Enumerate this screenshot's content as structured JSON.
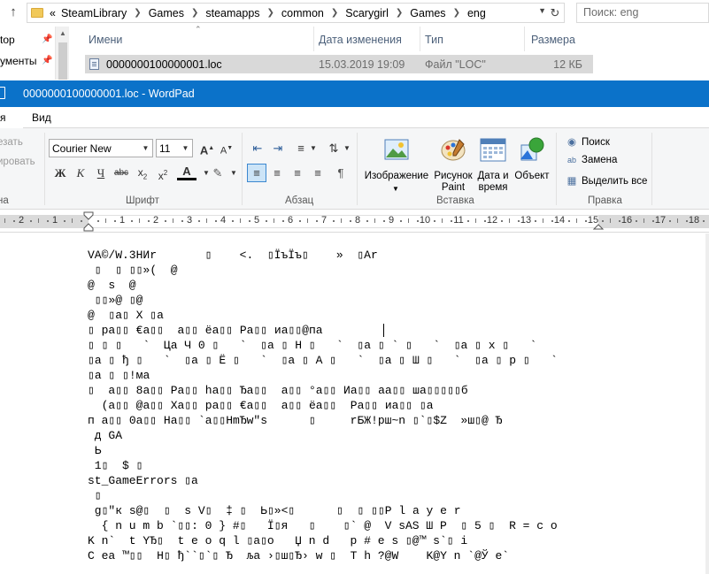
{
  "explorer": {
    "back_chevron": "«",
    "breadcrumb": [
      "SteamLibrary",
      "Games",
      "steamapps",
      "common",
      "Scarygirl",
      "Games",
      "eng"
    ],
    "search_placeholder": "Поиск: eng",
    "sidebar": [
      {
        "label": "top",
        "pinned": true
      },
      {
        "label": "ументы",
        "pinned": true
      }
    ],
    "columns": [
      "Имени",
      "Дата изменения",
      "Тип",
      "Размера"
    ],
    "file": {
      "name": "0000000100000001.loc",
      "modified": "15.03.2019 19:09",
      "type": "Файл \"LOC\"",
      "size": "12 КБ"
    }
  },
  "wordpad": {
    "title": "0000000100000001.loc - WordPad",
    "tabs": [
      "Главная",
      "Вид"
    ],
    "file_tab_visible": "я",
    "clipboard": {
      "cut": "езать",
      "copy": "ировать",
      "group": "на"
    },
    "font": {
      "family": "Courier New",
      "size": "11",
      "group": "Шрифт"
    },
    "paragraph": {
      "group": "Абзац"
    },
    "insert": {
      "group": "Вставка",
      "image_line1": "Изображение",
      "paint_line1": "Рисунок",
      "paint_line2": "Paint",
      "datetime_line1": "Дата и",
      "datetime_line2": "время",
      "object": "Объект"
    },
    "edit": {
      "group": "Правка",
      "find": "Поиск",
      "replace": "Замена",
      "select_all": "Выделить все"
    },
    "ruler_numbers": [
      "3",
      "2",
      "1",
      "",
      "1",
      "2",
      "3",
      "4",
      "5",
      "6",
      "7",
      "8",
      "9",
      "10",
      "11",
      "12",
      "13",
      "14",
      "15",
      "16",
      "17",
      "18"
    ],
    "document_lines": [
      "VA©/W.3НИr       ▯    <.  ▯ЇъЇъ▯    »  ▯Ar",
      " ▯  ▯ ▯▯»(  @",
      "@  s  @",
      " ▯▯»@ ▯@",
      "@  ▯a▯ X ▯a",
      "▯ pa▯▯ €a▯▯  a▯▯ ёa▯▯ Pa▯▯ иa▯▯@пa",
      "▯ ▯ ▯   `  Цa Ч 0 ▯   `  ▯a ▯ H ▯   `  ▯a ▯ ` ▯   `  ▯a ▯ x ▯   `",
      "▯a ▯ ђ ▯   `  ▯a ▯ Ё ▯   `  ▯a ▯ A ▯   `  ▯a ▯ Ш ▯   `  ▯a ▯ р ▯   `",
      "▯a ▯ ▯!мa",
      "▯  a▯▯ 8a▯▯ Pa▯▯ ha▯▯ Ђa▯▯  a▯▯ °a▯▯ Иa▯▯ aa▯▯ шa▯▯▯▯▯б",
      "  (a▯▯ @a▯▯ Xa▯▯ pa▯▯ €a▯▯  a▯▯ ёa▯▯  Pa▯▯ иa▯▯ ▯a",
      "п a▯▯ 0a▯▯ Ha▯▯ `a▯▯HmЂw\"s      ▯     rБЖ!рш~n ▯`▯$Z  »ш▯@ Ђ",
      " д GA",
      " Ь",
      " 1▯  $ ▯",
      "st_GameErrors ▯a",
      " ▯",
      " g▯\"к s@▯  ▯  s V▯  ‡ ▯  Ь▯»<▯      ▯  ▯ ▯▯P l a y e r",
      "  { n u m b `▯▯: 0 } #▯   Ї▯я   ▯    ▯` @  V sAS Ш P  ▯ 5 ▯  R = c o",
      "K n`  t YЂ▯  t e o q l ▯a▯o   Џ n d   p # e s ▯@™ s`▯ i",
      "C ea ™▯▯  H▯ ђ``▯`▯ Ђ  љa ›▯ш▯Ђ› w ▯  T h ?@W    K@Y n `@Ў e`"
    ]
  }
}
